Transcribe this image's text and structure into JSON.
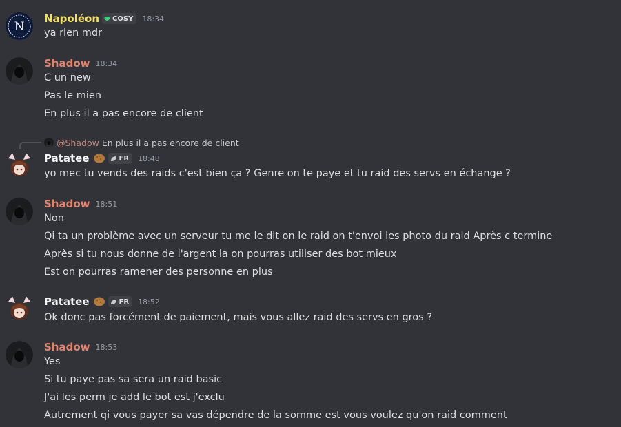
{
  "messages": [
    {
      "author": "Napoléon",
      "author_color": "#f0e06a",
      "tag": "COSY",
      "time": "18:34",
      "lines": [
        "ya rien mdr"
      ]
    },
    {
      "author": "Shadow",
      "author_color": "#e0846f",
      "time": "18:34",
      "lines": [
        "C un new",
        "Pas le mien",
        "En plus il a pas encore de client"
      ]
    },
    {
      "reply": {
        "mention": "@Shadow",
        "text": "En plus il a pas encore de client"
      },
      "author": "Patatee",
      "author_color": "#f2f3f5",
      "emoji": "potato-icon",
      "tag": "FR",
      "time": "18:48",
      "lines": [
        "yo mec tu vends des raids c'est bien ça ? Genre on te paye et tu raid des servs en échange ?"
      ]
    },
    {
      "author": "Shadow",
      "author_color": "#e0846f",
      "time": "18:51",
      "lines": [
        "Non",
        "Qi ta un problème avec un serveur tu me le dit on le raid on t'envoi les photo du raid Après c termine",
        "Après si tu nous donne de l'argent la on pourras utiliser des bot mieux",
        "Est on pourras ramener des personne en plus"
      ]
    },
    {
      "author": "Patatee",
      "author_color": "#f2f3f5",
      "emoji": "potato-icon",
      "tag": "FR",
      "time": "18:52",
      "lines": [
        "Ok donc pas forcément de paiement, mais vous allez raid des servs en gros ?"
      ]
    },
    {
      "author": "Shadow",
      "author_color": "#e0846f",
      "time": "18:53",
      "lines": [
        "Yes",
        "Si tu paye pas sa sera un raid basic",
        "J'ai les perm je add le bot est j'exclu",
        "Autrement qi vous payer sa vas dépendre de la somme est vous voulez qu'on raid comment"
      ]
    }
  ]
}
